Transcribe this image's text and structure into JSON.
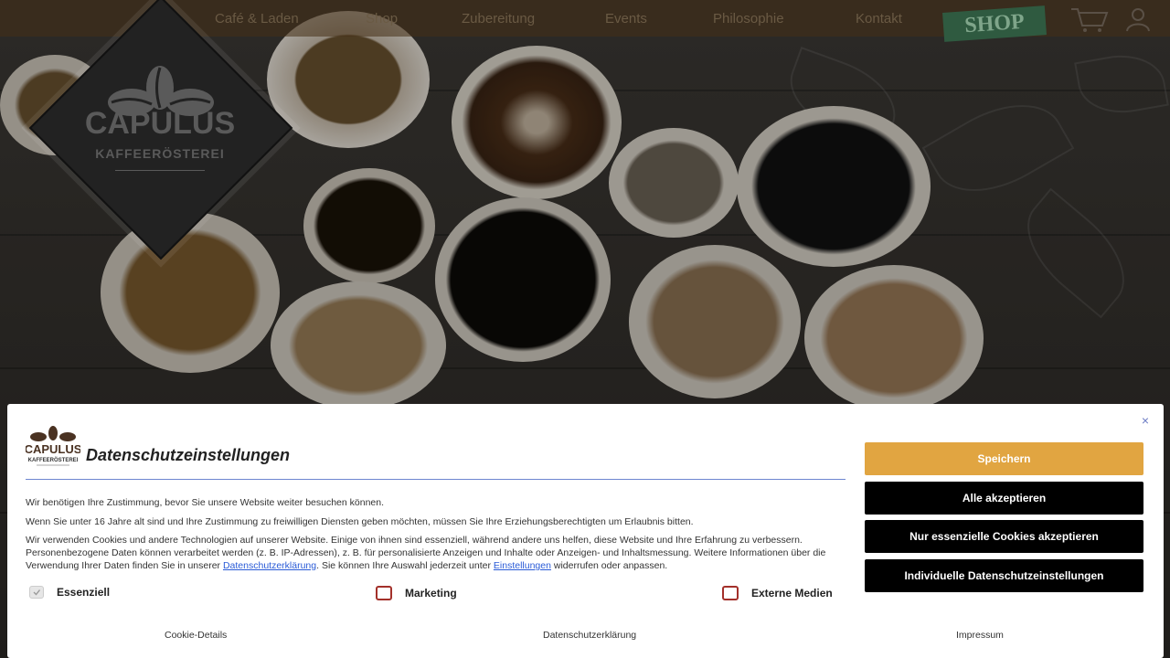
{
  "nav": {
    "items": [
      "Café & Laden",
      "Shop",
      "Zubereitung",
      "Events",
      "Philosophie",
      "Kontakt"
    ],
    "shop_badge": "SHOP",
    "icons": [
      "cart-icon",
      "user-icon"
    ]
  },
  "brand": {
    "name": "CAPULUS",
    "subtitle": "KAFFEERÖSTEREI"
  },
  "consent": {
    "title": "Datenschutzeinstellungen",
    "close_symbol": "×",
    "p1": "Wir benötigen Ihre Zustimmung, bevor Sie unsere Website weiter besuchen können.",
    "p2": "Wenn Sie unter 16 Jahre alt sind und Ihre Zustimmung zu freiwilligen Diensten geben möchten, müssen Sie Ihre Erziehungsberechtigten um Erlaubnis bitten.",
    "p3_start": "Wir verwenden Cookies und andere Technologien auf unserer Website. Einige von ihnen sind essenziell, während andere uns helfen, diese Website und Ihre Erfahrung zu verbessern. Personenbezogene Daten können verarbeitet werden (z. B. IP-Adressen), z. B. für personalisierte Anzeigen und Inhalte oder Anzeigen- und Inhaltsmessung. Weitere Informationen über die Verwendung Ihrer Daten finden Sie in unserer ",
    "p3_link1": "Datenschutzerklärung",
    "p3_mid": ". Sie können Ihre Auswahl jederzeit unter ",
    "p3_link2": "Einstellungen",
    "p3_end": " widerrufen oder anpassen.",
    "checkboxes": [
      {
        "label": "Essenziell",
        "checked": true,
        "disabled": true
      },
      {
        "label": "Marketing",
        "checked": false,
        "disabled": false
      },
      {
        "label": "Externe Medien",
        "checked": false,
        "disabled": false
      }
    ],
    "buttons": {
      "save": "Speichern",
      "accept_all": "Alle akzeptieren",
      "essential_only": "Nur essenzielle Cookies akzeptieren",
      "individual": "Individuelle Datenschutzeinstellungen"
    },
    "footer_links": [
      "Cookie-Details",
      "Datenschutzerklärung",
      "Impressum"
    ],
    "colors": {
      "accent": "#e1a541",
      "button_dark": "#000000",
      "checkbox_border": "#a3302a",
      "divider": "#6d86d0"
    }
  }
}
